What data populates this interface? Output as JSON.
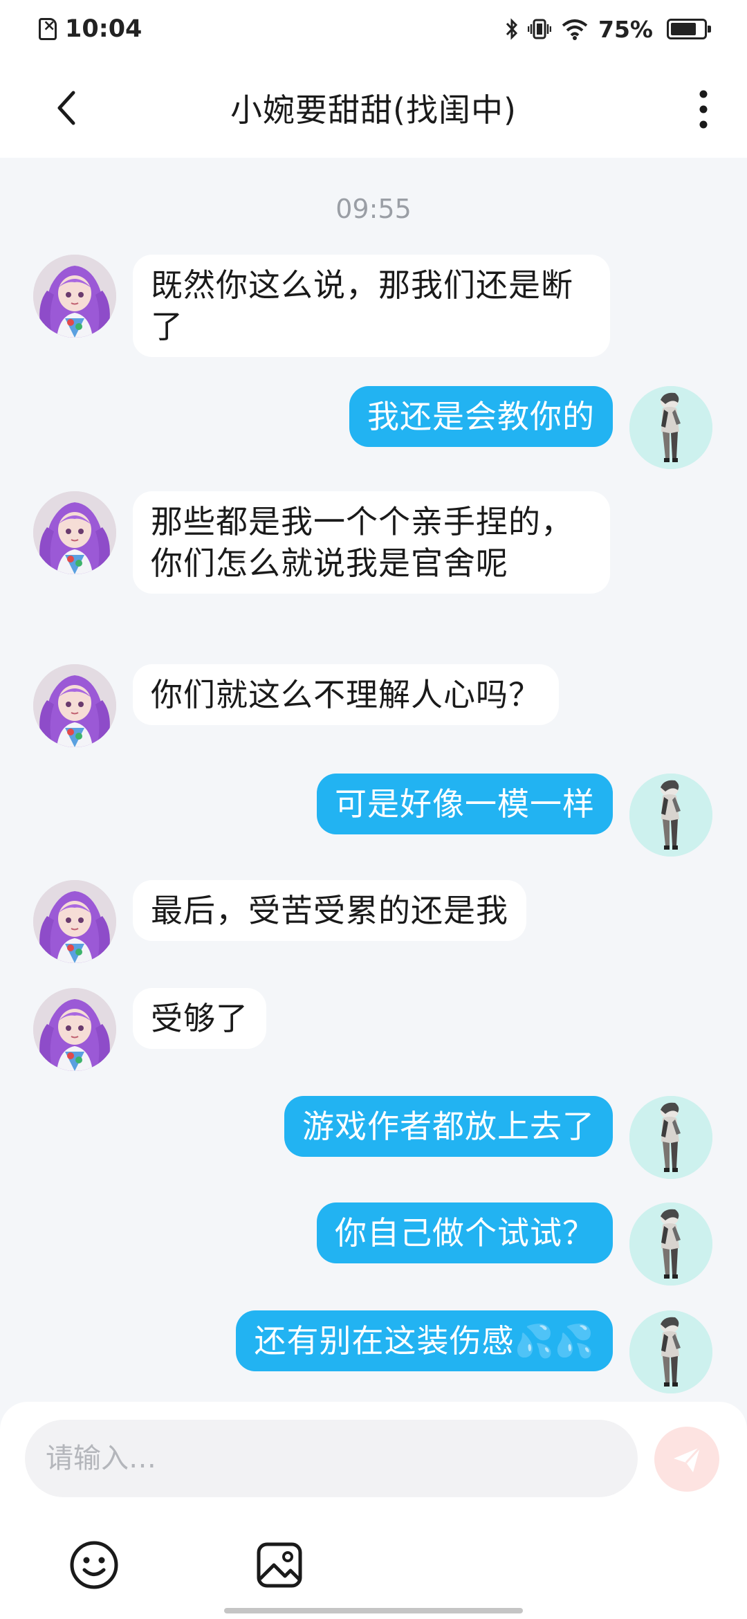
{
  "status_bar": {
    "time": "10:04",
    "battery": "75%",
    "icons": [
      "no-sim-icon",
      "bluetooth-icon",
      "vibrate-icon",
      "wifi-icon",
      "battery-icon"
    ]
  },
  "header": {
    "title": "小婉要甜甜(找闺中)",
    "back_icon": "chevron-left-icon",
    "more_icon": "more-vertical-icon"
  },
  "chat": {
    "timestamp": "09:55",
    "messages": [
      {
        "from": "them",
        "text": "既然你这么说，那我们还是断了"
      },
      {
        "from": "me",
        "text": "我还是会教你的"
      },
      {
        "from": "them",
        "text": "那些都是我一个个亲手捏的，你们怎么就说我是官舍呢"
      },
      {
        "from": "them",
        "text": "你们就这么不理解人心吗？"
      },
      {
        "from": "me",
        "text": "可是好像一模一样"
      },
      {
        "from": "them",
        "text": "最后，受苦受累的还是我"
      },
      {
        "from": "them",
        "text": "受够了"
      },
      {
        "from": "me",
        "text": "游戏作者都放上去了"
      },
      {
        "from": "me",
        "text": "你自己做个试试？"
      },
      {
        "from": "me",
        "text": "还有别在这装伤感💦💦"
      }
    ]
  },
  "composer": {
    "placeholder": "请输入…",
    "send_icon": "send-icon",
    "emoji_icon": "emoji-icon",
    "image_icon": "image-icon"
  },
  "colors": {
    "outgoing_bubble": "#22b3f2",
    "incoming_bubble": "#ffffff",
    "background": "#f4f6f9",
    "send_button": "#fde3e1"
  }
}
